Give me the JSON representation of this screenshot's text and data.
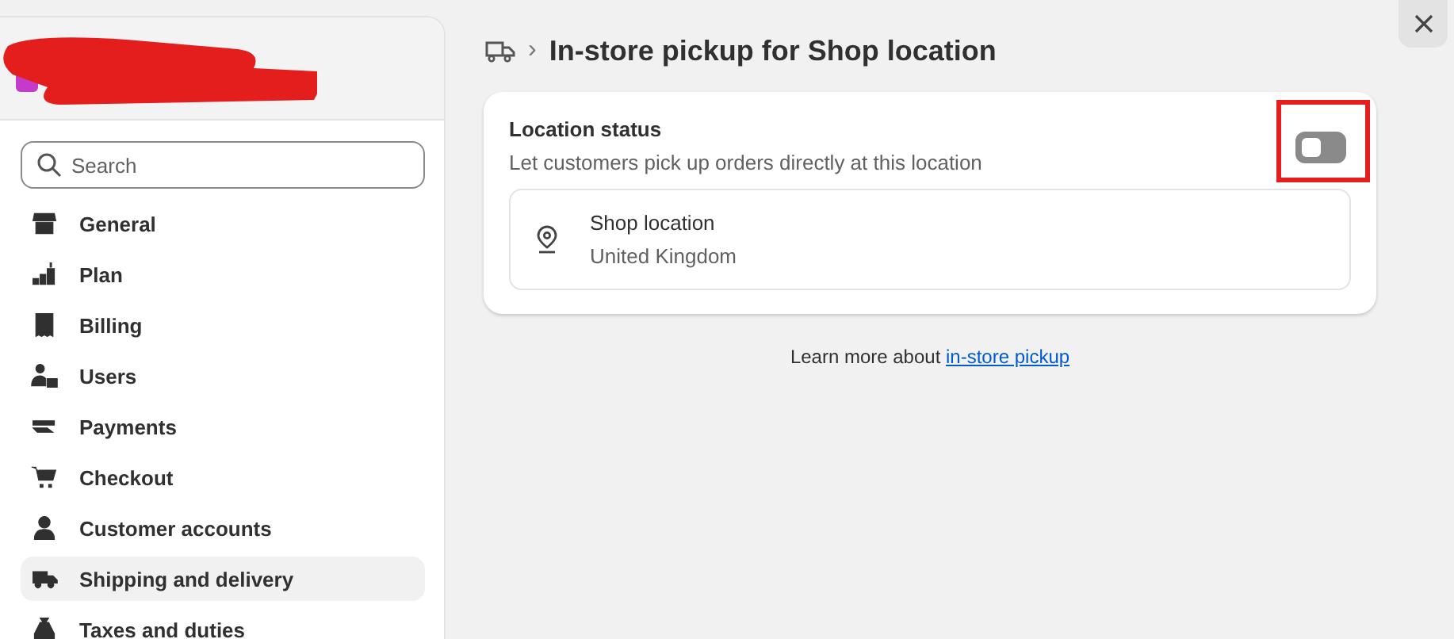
{
  "sidebar": {
    "search": {
      "placeholder": "Search"
    },
    "items": [
      {
        "label": "General",
        "selected": false
      },
      {
        "label": "Plan",
        "selected": false
      },
      {
        "label": "Billing",
        "selected": false
      },
      {
        "label": "Users",
        "selected": false
      },
      {
        "label": "Payments",
        "selected": false
      },
      {
        "label": "Checkout",
        "selected": false
      },
      {
        "label": "Customer accounts",
        "selected": false
      },
      {
        "label": "Shipping and delivery",
        "selected": true
      },
      {
        "label": "Taxes and duties",
        "selected": false
      }
    ]
  },
  "header": {
    "breadcrumb_separator": "›",
    "title": "In-store pickup for Shop location"
  },
  "card": {
    "title": "Location status",
    "description": "Let customers pick up orders directly at this location",
    "toggle": {
      "on": false
    },
    "location": {
      "name": "Shop location",
      "country": "United Kingdom"
    }
  },
  "footer": {
    "text": "Learn more about ",
    "link": "in-store pickup"
  }
}
